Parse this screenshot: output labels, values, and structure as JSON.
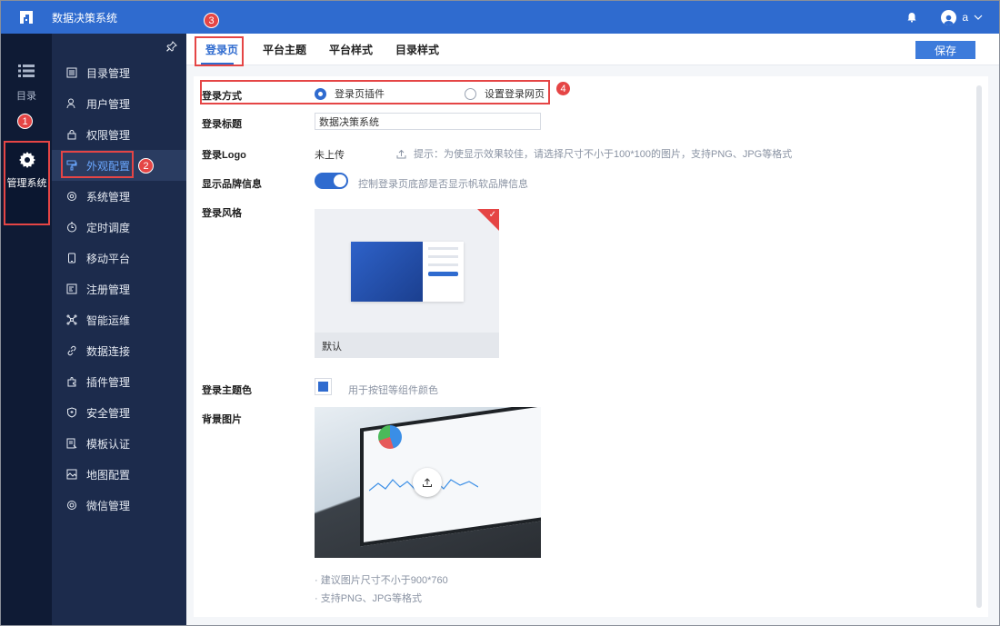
{
  "app": {
    "title": "数据决策系统"
  },
  "user": {
    "name": "a"
  },
  "rail": {
    "catalog_label": "目录",
    "admin_label": "管理系统"
  },
  "badges": [
    "1",
    "2",
    "3",
    "4"
  ],
  "menu": {
    "items": [
      {
        "label": "目录管理",
        "icon": "list-icon"
      },
      {
        "label": "用户管理",
        "icon": "user-icon"
      },
      {
        "label": "权限管理",
        "icon": "lock-icon"
      },
      {
        "label": "外观配置",
        "icon": "paint-icon",
        "active": true
      },
      {
        "label": "系统管理",
        "icon": "gear-icon"
      },
      {
        "label": "定时调度",
        "icon": "timer-icon"
      },
      {
        "label": "移动平台",
        "icon": "mobile-icon"
      },
      {
        "label": "注册管理",
        "icon": "register-icon"
      },
      {
        "label": "智能运维",
        "icon": "network-icon"
      },
      {
        "label": "数据连接",
        "icon": "link-icon"
      },
      {
        "label": "插件管理",
        "icon": "plugin-icon"
      },
      {
        "label": "安全管理",
        "icon": "shield-icon"
      },
      {
        "label": "模板认证",
        "icon": "template-icon"
      },
      {
        "label": "地图配置",
        "icon": "map-icon"
      },
      {
        "label": "微信管理",
        "icon": "wechat-icon"
      }
    ]
  },
  "tabs": [
    {
      "label": "登录页",
      "active": true
    },
    {
      "label": "平台主题"
    },
    {
      "label": "平台样式"
    },
    {
      "label": "目录样式"
    }
  ],
  "toolbar": {
    "save_label": "保存"
  },
  "form": {
    "login_method": {
      "label": "登录方式",
      "options": [
        "登录页插件",
        "设置登录网页"
      ],
      "selected": "登录页插件"
    },
    "login_title": {
      "label": "登录标题",
      "value": "数据决策系统"
    },
    "login_logo": {
      "label": "登录Logo",
      "status": "未上传",
      "tip": "提示：为使显示效果较佳，请选择尺寸不小于100*100的图片，支持PNG、JPG等格式"
    },
    "brand_info": {
      "label": "显示品牌信息",
      "enabled": true,
      "desc": "控制登录页底部是否显示帆软品牌信息"
    },
    "login_style": {
      "label": "登录风格",
      "selected_name": "默认"
    },
    "theme_color": {
      "label": "登录主题色",
      "desc": "用于按钮等组件颜色",
      "color": "#2f6bcf"
    },
    "background": {
      "label": "背景图片",
      "notes": [
        "· 建议图片尺寸不小于900*760",
        "· 支持PNG、JPG等格式"
      ]
    }
  },
  "colors": {
    "topbar": "#2f6bcf",
    "rail": "#0f1b35",
    "sidemenu": "#1c2b4c",
    "highlight": "#e54545"
  }
}
